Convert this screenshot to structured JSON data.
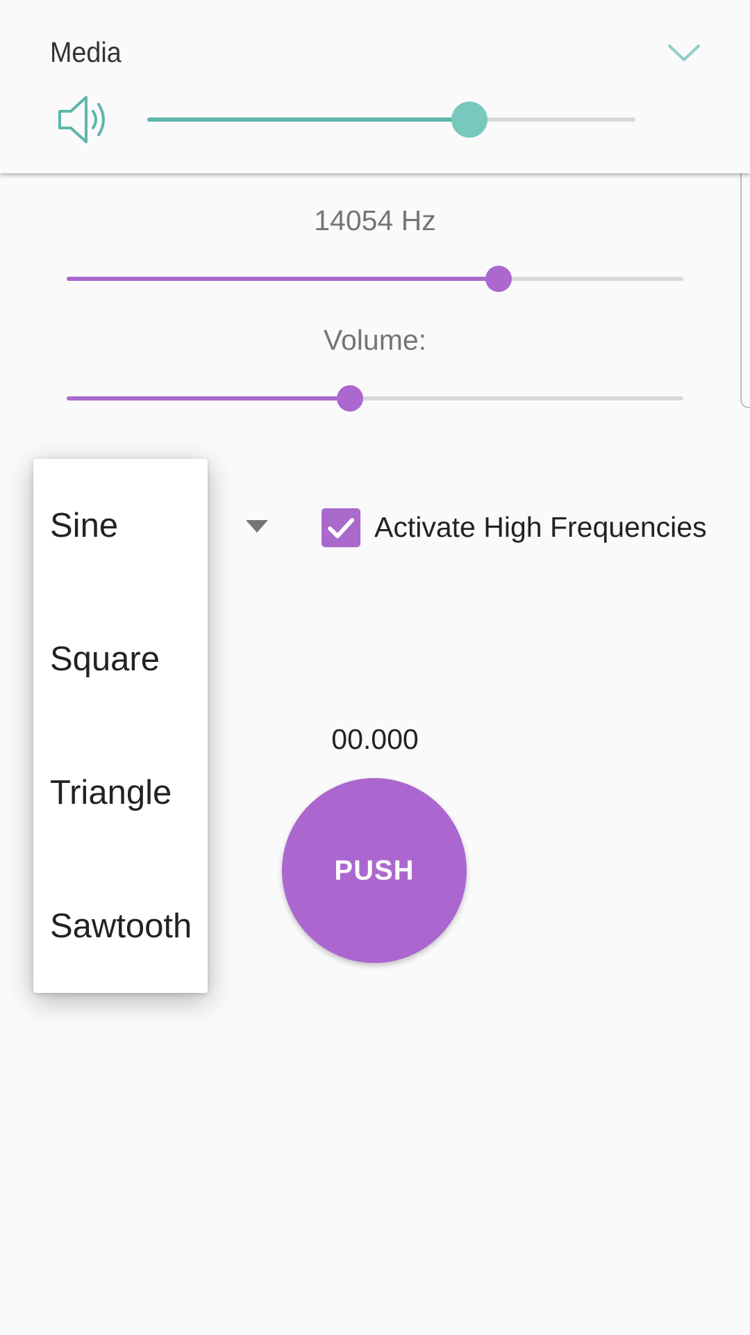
{
  "media_panel": {
    "title": "Media",
    "volume_level": 0.66,
    "accent_color": "#5db6ab",
    "icons": [
      "speaker-icon",
      "chevron-down-icon"
    ]
  },
  "generator": {
    "frequency_label": "14054 Hz",
    "frequency_slider_level": 0.7,
    "volume_label": "Volume:",
    "volume_slider_level": 0.46,
    "accent_color": "#a96acb"
  },
  "waveform_dropdown": {
    "options": [
      "Sine",
      "Square",
      "Triangle",
      "Sawtooth"
    ],
    "icon": "dropdown-arrow-icon"
  },
  "high_freq_checkbox": {
    "label": "Activate High Frequencies",
    "checked": true
  },
  "timer": "00.000",
  "push_button_label": "PUSH"
}
